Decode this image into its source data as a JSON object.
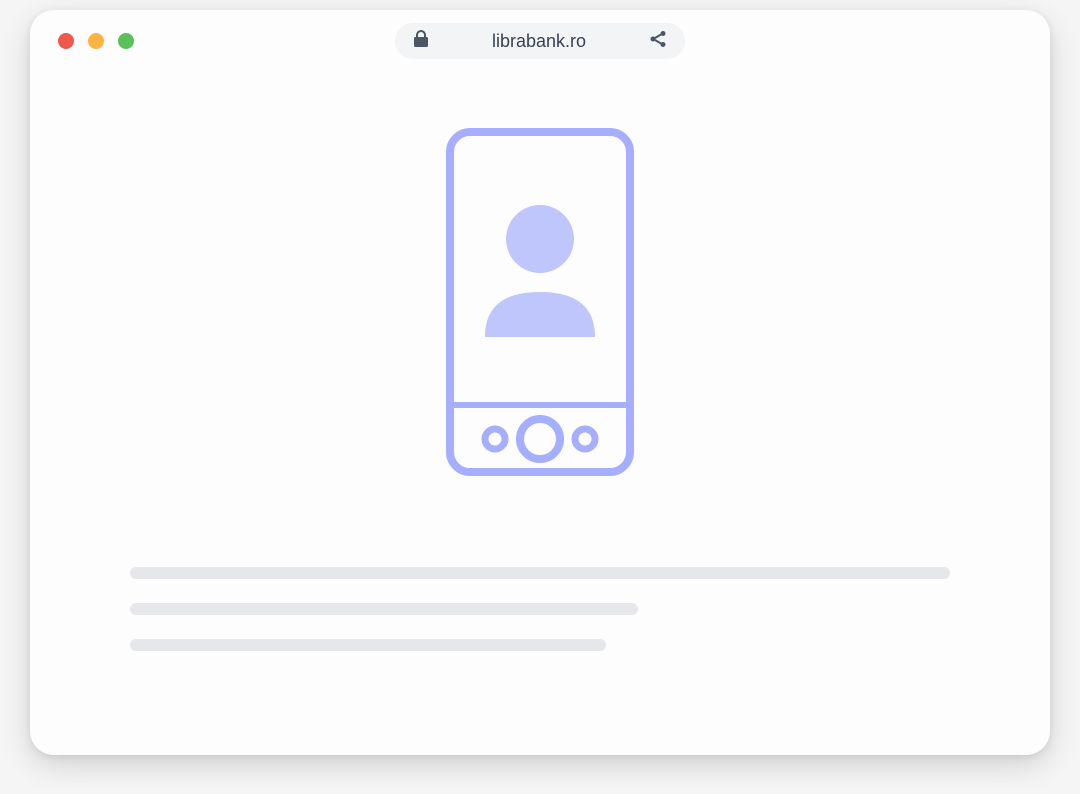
{
  "browser": {
    "url": "librabank.ro"
  },
  "colors": {
    "accent": "#A5AEFF",
    "accentFill": "#BFC6FC",
    "placeholder": "#E5E7EB"
  }
}
